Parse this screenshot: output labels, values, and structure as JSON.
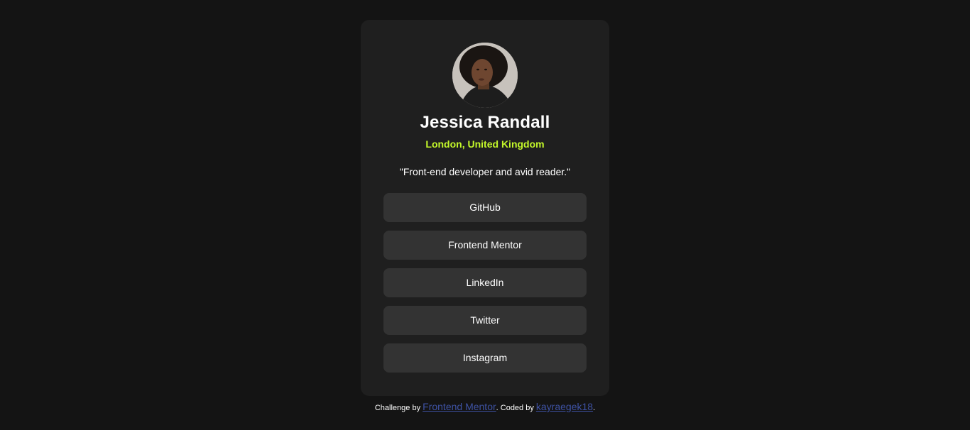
{
  "profile": {
    "name": "Jessica Randall",
    "location": "London, United Kingdom",
    "bio": "\"Front-end developer and avid reader.\""
  },
  "links": [
    {
      "label": "GitHub"
    },
    {
      "label": "Frontend Mentor"
    },
    {
      "label": "LinkedIn"
    },
    {
      "label": "Twitter"
    },
    {
      "label": "Instagram"
    }
  ],
  "footer": {
    "prefix": "Challenge by ",
    "challenge_link": "Frontend Mentor",
    "middle": ". Coded by ",
    "author_link": "kayraegek18",
    "suffix": "."
  },
  "colors": {
    "background": "#141414",
    "card": "#1f1f1f",
    "button": "#333333",
    "accent": "#c4f82a",
    "footer_link": "#3e52a3"
  }
}
